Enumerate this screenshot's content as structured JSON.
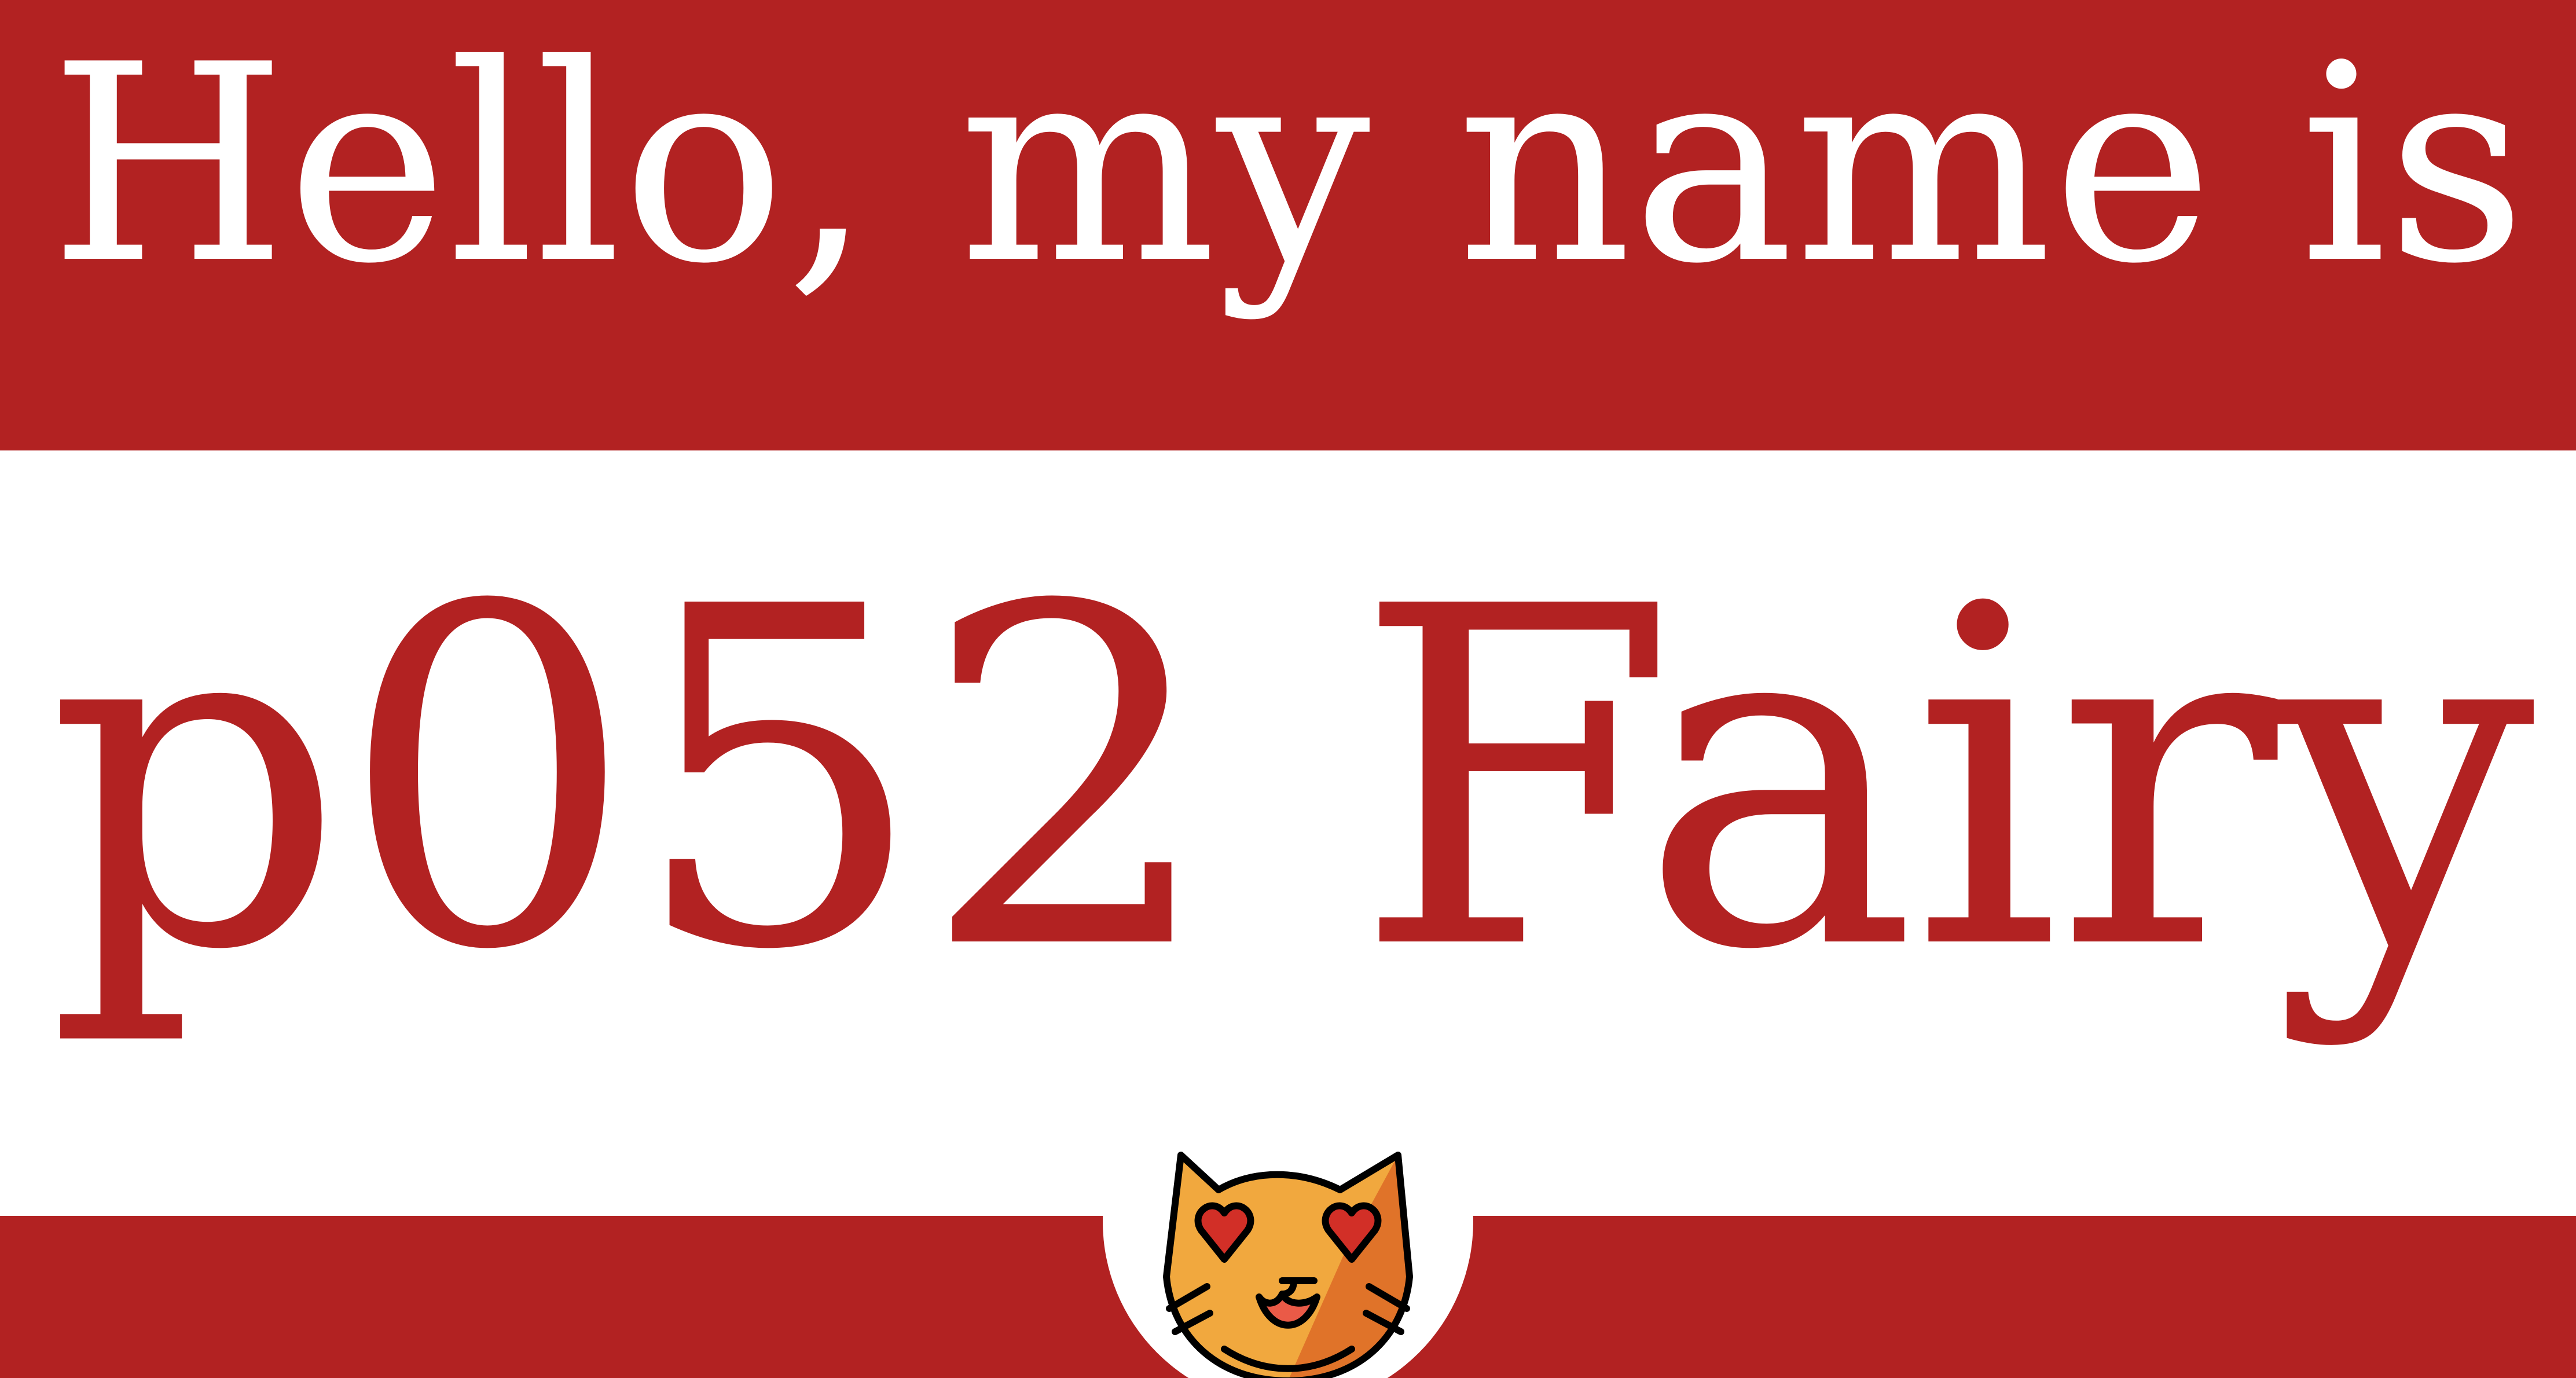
{
  "tag": {
    "greeting": "Hello, my name is",
    "name": "p052 Fairy"
  },
  "emblem": {
    "icon": "cat-face-heart-eyes-icon"
  },
  "colors": {
    "band": "#b22222",
    "background": "#ffffff",
    "greeting_text": "#ffffff",
    "name_text": "#b22222",
    "cat_fur": "#f1a83e",
    "cat_shade": "#e07329",
    "cat_hearts": "#d22f27",
    "cat_mouth": "#ea5a47"
  }
}
